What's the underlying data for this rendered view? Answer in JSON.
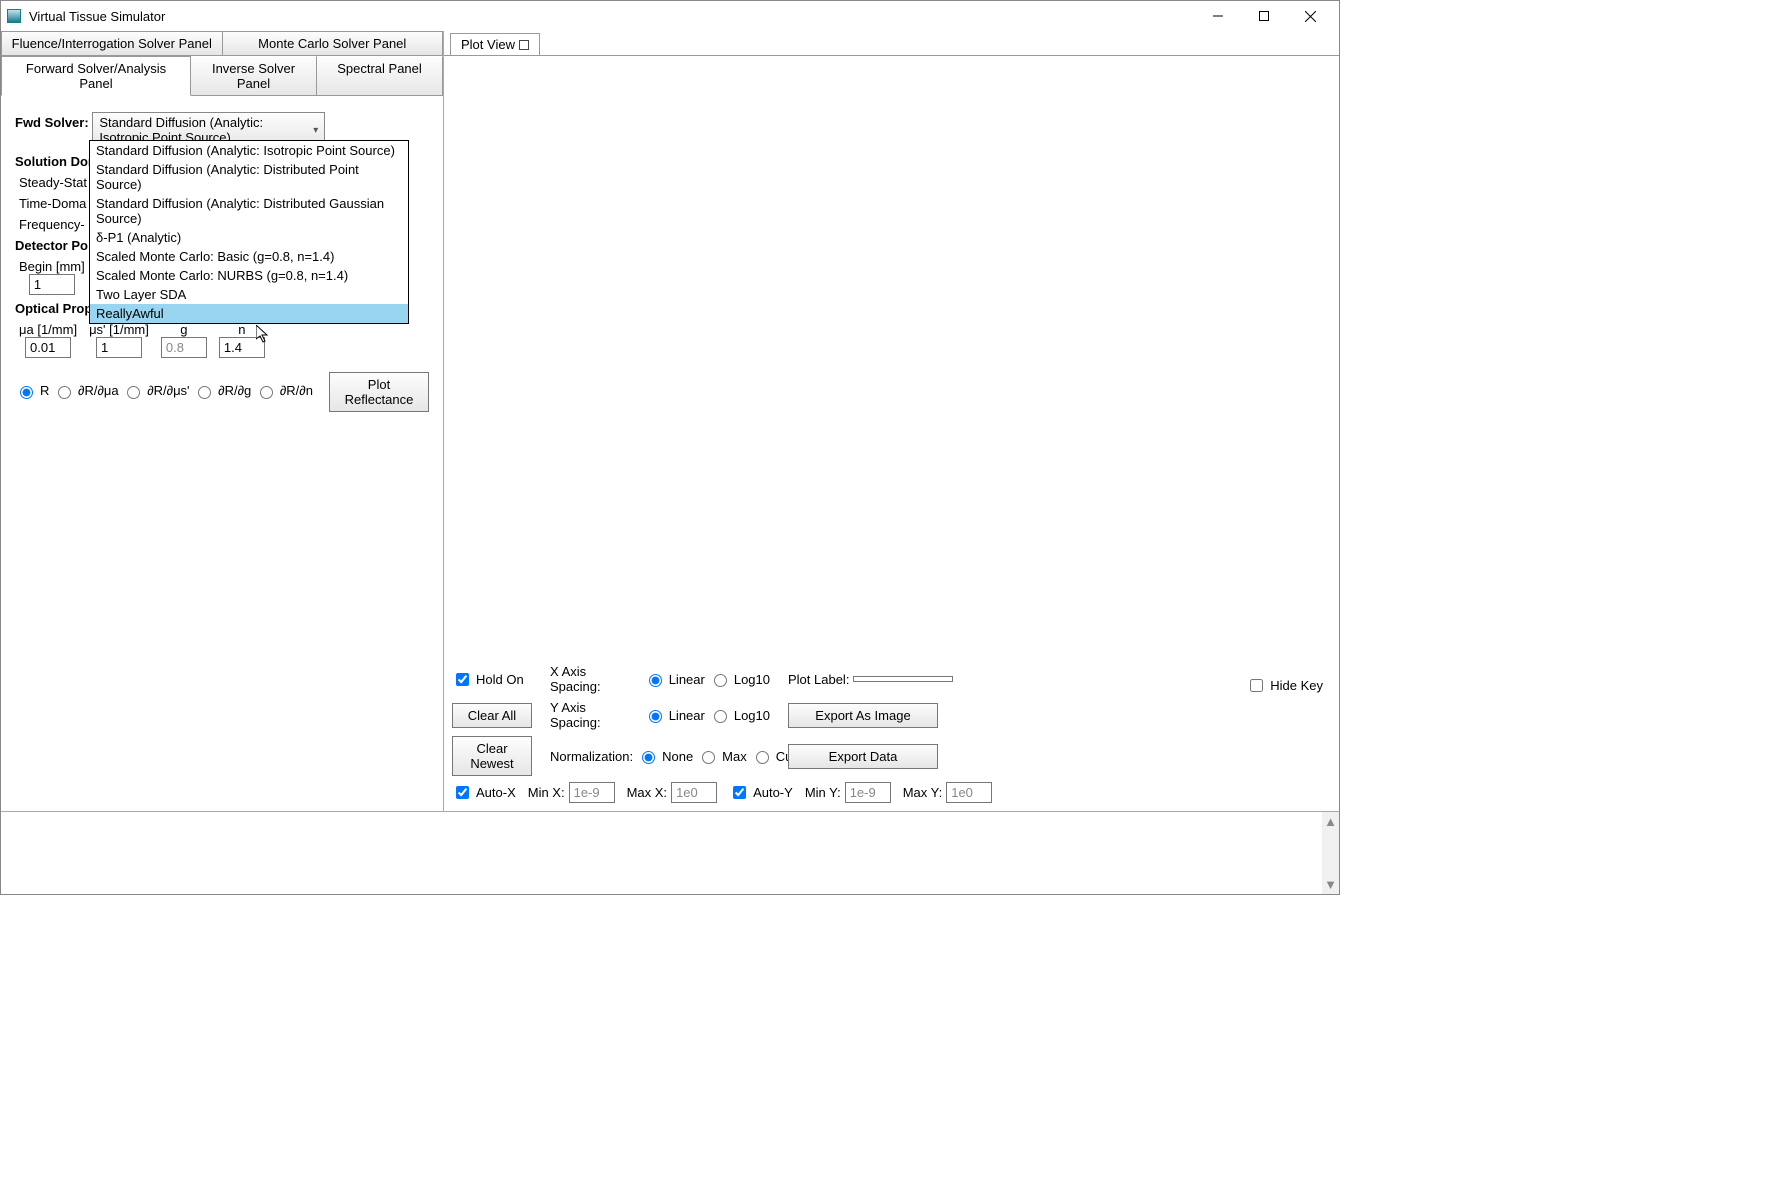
{
  "window": {
    "title": "Virtual Tissue Simulator"
  },
  "tabs_top": {
    "fluence": "Fluence/Interrogation Solver Panel",
    "monte": "Monte Carlo Solver Panel"
  },
  "tabs_sub": {
    "forward": "Forward Solver/Analysis Panel",
    "inverse": "Inverse Solver Panel",
    "spectral": "Spectral Panel"
  },
  "plot_tab": "Plot View",
  "fwd_solver": {
    "label": "Fwd Solver:",
    "selected": "Standard Diffusion (Analytic: Isotropic Point Source)",
    "options": [
      "Standard Diffusion (Analytic: Isotropic Point Source)",
      "Standard Diffusion (Analytic: Distributed Point Source)",
      "Standard Diffusion (Analytic: Distributed Gaussian Source)",
      "δ-P1 (Analytic)",
      "Scaled Monte Carlo: Basic (g=0.8, n=1.4)",
      "Scaled Monte Carlo: NURBS (g=0.8, n=1.4)",
      "Two Layer SDA",
      "ReallyAwful"
    ],
    "highlight_index": 7
  },
  "solution_domain": {
    "label": "Solution Domain:",
    "steady_prefix": "Steady-Stat",
    "time_prefix": "Time-Doma",
    "freq_prefix": "Frequency-"
  },
  "detector": {
    "label": "Detector Po",
    "begin_label": "Begin [mm]",
    "begin_value": "1"
  },
  "optical": {
    "label": "Optical Properties:",
    "mua_label": "μa [1/mm]",
    "mua_value": "0.01",
    "musp_label": "μs' [1/mm]",
    "musp_value": "1",
    "g_label": "g",
    "g_value": "0.8",
    "n_label": "n",
    "n_value": "1.4"
  },
  "output_radios": {
    "r": "R",
    "drmua": "∂R/∂μa",
    "drmusp": "∂R/∂μs'",
    "drg": "∂R/∂g",
    "drn": "∂R/∂n"
  },
  "plot_button": "Plot Reflectance",
  "plot_controls": {
    "hide_key": "Hide Key",
    "hold_on": "Hold On",
    "clear_all": "Clear All",
    "clear_newest": "Clear Newest",
    "x_spacing_label": "X Axis Spacing:",
    "y_spacing_label": "Y Axis Spacing:",
    "normalization_label": "Normalization:",
    "linear": "Linear",
    "log10": "Log10",
    "none": "None",
    "max": "Max",
    "curve": "Curve",
    "plot_label_label": "Plot Label:",
    "plot_label_value": "",
    "export_image": "Export As Image",
    "export_data": "Export Data",
    "auto_x": "Auto-X",
    "auto_y": "Auto-Y",
    "min_x_label": "Min X:",
    "min_x_value": "1e-9",
    "max_x_label": "Max X:",
    "max_x_value": "1e0",
    "min_y_label": "Min Y:",
    "min_y_value": "1e-9",
    "max_y_label": "Max Y:",
    "max_y_value": "1e0"
  }
}
